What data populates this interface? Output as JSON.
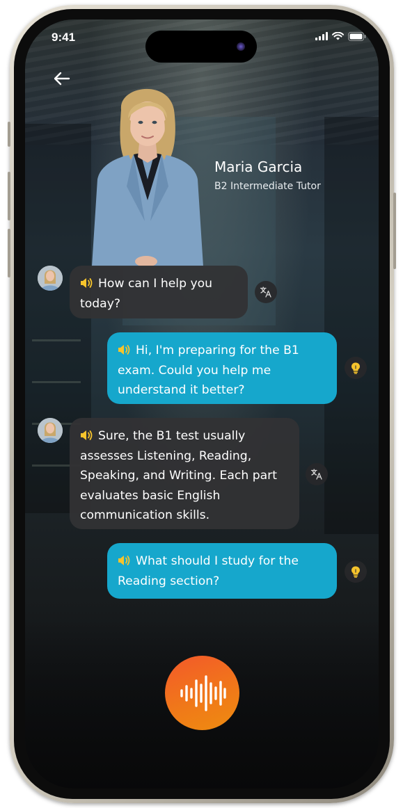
{
  "status_bar": {
    "time": "9:41",
    "icons": [
      "cellular-icon",
      "wifi-icon",
      "battery-icon"
    ]
  },
  "header": {
    "back_icon": "arrow-left-icon"
  },
  "tutor": {
    "name": "Maria Garcia",
    "level": "B2 Intermediate Tutor"
  },
  "messages": [
    {
      "sender": "tutor",
      "text": "How can I help you today?",
      "side_icon": "translate-icon"
    },
    {
      "sender": "user",
      "text": "Hi, I'm preparing for the B1 exam. Could you help me understand it better?",
      "side_icon": "lightbulb-icon"
    },
    {
      "sender": "tutor",
      "text": "Sure, the B1 test usually assesses Listening, Reading, Speaking, and Writing. Each part evaluates basic English communication skills.",
      "side_icon": "translate-icon"
    },
    {
      "sender": "user",
      "text": "What should I study for the Reading section?",
      "side_icon": "lightbulb-icon"
    }
  ],
  "controls": {
    "voice_icon": "waveform-icon"
  },
  "colors": {
    "user_bubble": "#16a7cc",
    "tutor_bubble": "#323234",
    "speaker_icon": "#f6c42c",
    "record_button": "#f06a20"
  }
}
